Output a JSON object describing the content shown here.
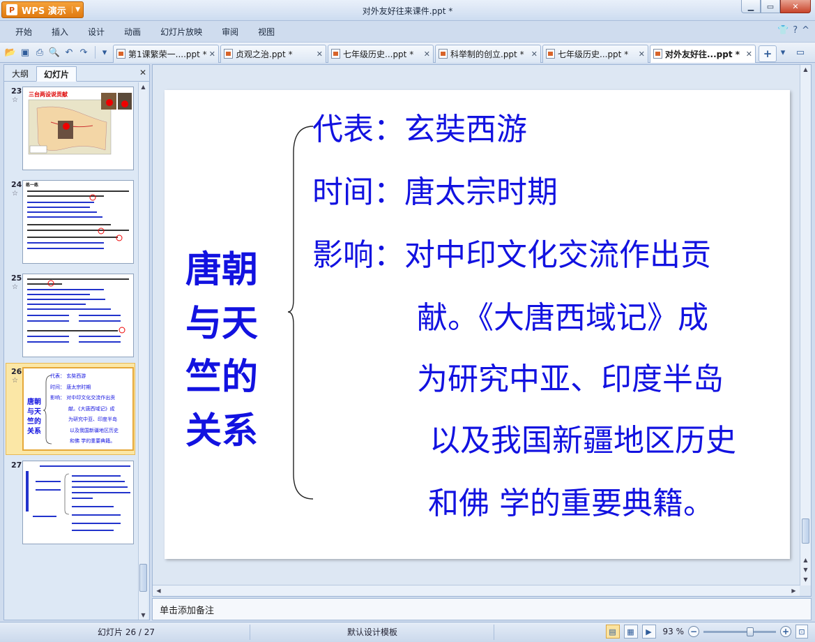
{
  "app": {
    "name": "WPS 演示",
    "window_title": "对外友好往来课件.ppt *"
  },
  "menu": [
    "开始",
    "插入",
    "设计",
    "动画",
    "幻灯片放映",
    "审阅",
    "视图"
  ],
  "doc_tabs": [
    {
      "label": "第1课繁荣一....ppt *",
      "active": false
    },
    {
      "label": "贞观之治.ppt *",
      "active": false
    },
    {
      "label": "七年级历史...ppt *",
      "active": false
    },
    {
      "label": "科举制的创立.ppt *",
      "active": false
    },
    {
      "label": "七年级历史...ppt *",
      "active": false
    },
    {
      "label": "对外友好往...ppt *",
      "active": true
    }
  ],
  "left_panel": {
    "tabs": [
      "大纲",
      "幻灯片"
    ],
    "active_tab": "幻灯片",
    "thumbnails": [
      {
        "number": "23",
        "title": "三台两设说贡献"
      },
      {
        "number": "24",
        "title": "练一练"
      },
      {
        "number": "25",
        "title": ""
      },
      {
        "number": "26",
        "selected": true
      },
      {
        "number": "27"
      }
    ],
    "thumb26": {
      "left": [
        "唐朝",
        "与天",
        "竺的",
        "关系"
      ],
      "lines": [
        "代表：  玄奘西游",
        "时间：  唐太宗时期",
        "影响：  对中印文化交流作出贡",
        "献。《大唐西域记》成",
        "为研究中亚、印度半岛",
        "以及我国新疆地区历史",
        "和佛 学的重要典籍。"
      ]
    }
  },
  "slide": {
    "left_title": [
      "唐朝",
      "与天",
      "竺的",
      "关系"
    ],
    "lines": [
      {
        "label": "代表：",
        "text": "玄奘西游"
      },
      {
        "label": "时间：",
        "text": "唐太宗时期"
      },
      {
        "label": "影响：",
        "text": "对中印文化交流作出贡"
      }
    ],
    "continuation": [
      "献。《大唐西域记》成",
      "为研究中亚、印度半岛",
      "以及我国新疆地区历史",
      "和佛 学的重要典籍。"
    ],
    "text_color": "#1212e0"
  },
  "notes_placeholder": "单击添加备注",
  "status": {
    "slide_counter": "幻灯片 26 / 27",
    "template": "默认设计模板",
    "zoom": "93 %"
  }
}
